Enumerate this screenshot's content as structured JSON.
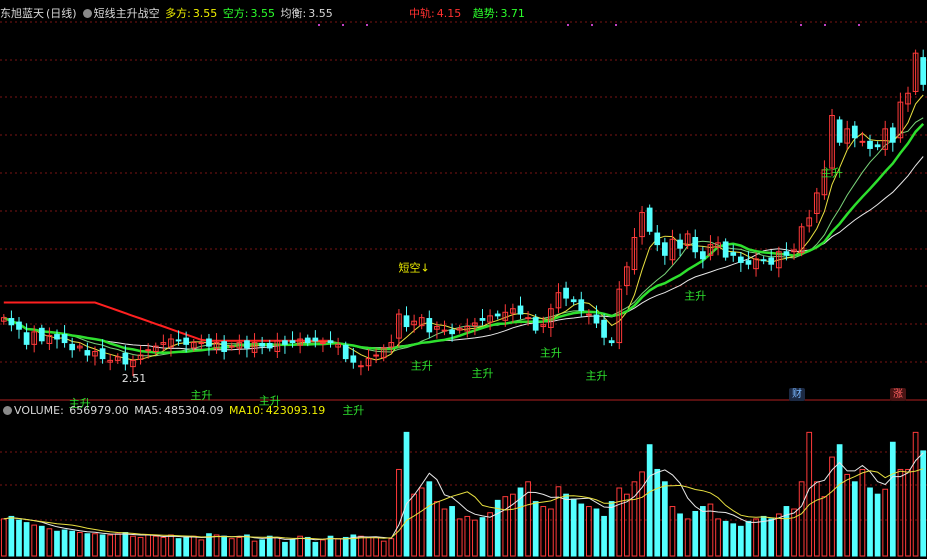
{
  "header_main": {
    "stock": "东旭蓝天",
    "period": "(日线)",
    "indicator": "短线主升战空",
    "duofang_label": "多方:",
    "duofang_value": "3.55",
    "kongfang_label": "空方:",
    "kongfang_value": "3.55",
    "junheng_label": "均衡:",
    "junheng_value": "3.55",
    "zhonggui_label": "中轨:",
    "zhonggui_value": "4.15",
    "qushi_label": "趋势:",
    "qushi_value": "3.71"
  },
  "header_volume": {
    "volume_label": "VOLUME:",
    "volume_value": "656979.00",
    "ma5_label": "MA5:",
    "ma5_value": "485304.09",
    "ma10_label": "MA10:",
    "ma10_value": "423093.19"
  },
  "badges": {
    "cai": "财",
    "zhang": "涨"
  },
  "colors": {
    "up": "#ff3a3a",
    "down": "#54ffff",
    "trend": "#2ee02e",
    "upper": "#ff2020",
    "ma_white": "#e8e8e8",
    "ma_yellow": "#e8e040",
    "ma_green": "#7ad47a",
    "grid": "#7a1414"
  },
  "chart_data": [
    {
      "type": "candlestick",
      "title": "短线主升战空",
      "y_range": [
        2.2,
        6.4
      ],
      "candles_close": [
        3.08,
        3.0,
        2.95,
        2.78,
        2.92,
        2.82,
        2.88,
        2.84,
        2.8,
        2.72,
        2.76,
        2.66,
        2.7,
        2.62,
        2.6,
        2.64,
        2.56,
        2.6,
        2.66,
        2.72,
        2.76,
        2.8,
        2.84,
        2.82,
        2.78,
        2.8,
        2.8,
        2.76,
        2.8,
        2.7,
        2.76,
        2.8,
        2.74,
        2.8,
        2.76,
        2.74,
        2.82,
        2.78,
        2.8,
        2.84,
        2.8,
        2.82,
        2.8,
        2.8,
        2.78,
        2.62,
        2.58,
        2.54,
        2.62,
        2.66,
        2.74,
        2.8,
        3.12,
        2.98,
        3.04,
        3.08,
        2.92,
        2.98,
        2.94,
        2.9,
        2.96,
        2.98,
        3.02,
        3.05,
        3.1,
        3.1,
        3.14,
        3.18,
        3.12,
        3.08,
        2.94,
        3.0,
        3.18,
        3.36,
        3.3,
        3.26,
        3.16,
        3.12,
        3.02,
        2.86,
        2.8,
        3.4,
        3.65,
        3.98,
        4.26,
        4.05,
        3.9,
        3.78,
        3.96,
        3.86,
        4.02,
        3.82,
        3.74,
        3.9,
        3.92,
        3.76,
        3.78,
        3.7,
        3.68,
        3.74,
        3.72,
        3.68,
        3.82,
        3.78,
        3.84,
        4.1,
        4.2,
        4.48,
        4.74,
        5.35,
        5.05,
        5.2,
        5.1,
        5.06,
        4.98,
        5.0,
        5.2,
        5.05,
        5.5,
        5.6,
        6.05,
        5.7
      ],
      "annotations": [
        "短空↓",
        "主升",
        "2.51"
      ],
      "overlays": [
        "趋势",
        "中轨",
        "MA5",
        "MA10",
        "MA20"
      ]
    },
    {
      "type": "bar",
      "title": "VOLUME",
      "series": [
        {
          "name": "VOLUME",
          "values": [
            30,
            32,
            29,
            27,
            25,
            24,
            22,
            20,
            21,
            20,
            19,
            18,
            18,
            17,
            17,
            18,
            19,
            16,
            15,
            17,
            16,
            15,
            17,
            14,
            15,
            16,
            13,
            18,
            17,
            16,
            14,
            15,
            17,
            12,
            13,
            16,
            15,
            11,
            13,
            16,
            15,
            11,
            13,
            16,
            14,
            15,
            17,
            16,
            15,
            15,
            12,
            14,
            70,
            100,
            50,
            55,
            60,
            44,
            38,
            40,
            30,
            32,
            29,
            31,
            35,
            45,
            48,
            50,
            55,
            60,
            44,
            40,
            38,
            56,
            50,
            46,
            42,
            40,
            38,
            32,
            44,
            55,
            50,
            60,
            68,
            90,
            70,
            60,
            40,
            34,
            30,
            36,
            40,
            42,
            30,
            28,
            26,
            24,
            28,
            30,
            32,
            30,
            34,
            40,
            38,
            60,
            100,
            60,
            48,
            80,
            90,
            66,
            60,
            70,
            55,
            50,
            54,
            92,
            70,
            70,
            100,
            85
          ]
        }
      ]
    }
  ]
}
